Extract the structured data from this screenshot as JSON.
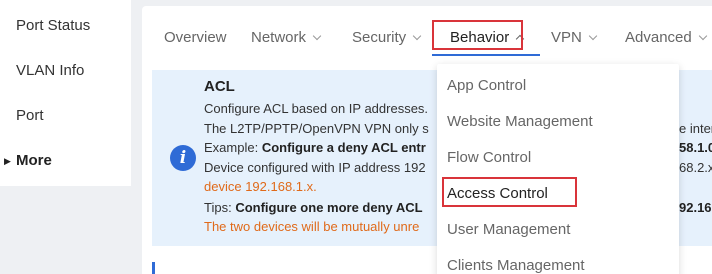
{
  "sidebar": {
    "items": [
      {
        "label": "Port Status"
      },
      {
        "label": "VLAN Info"
      },
      {
        "label": "Port"
      },
      {
        "label": "More"
      }
    ]
  },
  "tabs": [
    {
      "label": "Overview"
    },
    {
      "label": "Network"
    },
    {
      "label": "Security"
    },
    {
      "label": "Behavior"
    },
    {
      "label": "VPN"
    },
    {
      "label": "Advanced"
    }
  ],
  "notice": {
    "title": "ACL",
    "line1": "Configure ACL based on IP addresses.",
    "line2": "The L2TP/PPTP/OpenVPN VPN only s",
    "line2_tail": "e inter",
    "line3_prefix": "Example: ",
    "line3_bold": "Configure a deny ACL entr",
    "line3_tail": "58.1.0",
    "line4": "Device configured with IP address 192",
    "line4_tail": "68.2.x",
    "line5": "device 192.168.1.x.",
    "line6_prefix": "Tips: ",
    "line6_bold": "Configure one more deny ACL",
    "line6_tail": "92.16",
    "line7": "The two devices will be mutually unre"
  },
  "dropdown": {
    "items": [
      {
        "label": "App Control"
      },
      {
        "label": "Website Management"
      },
      {
        "label": "Flow Control"
      },
      {
        "label": "Access Control"
      },
      {
        "label": "User Management"
      },
      {
        "label": "Clients Management"
      }
    ]
  },
  "colors": {
    "accent": "#2f6bd6",
    "highlight": "#d9343a",
    "warning_text": "#e06a1a",
    "notice_bg": "#e6f1fc"
  }
}
